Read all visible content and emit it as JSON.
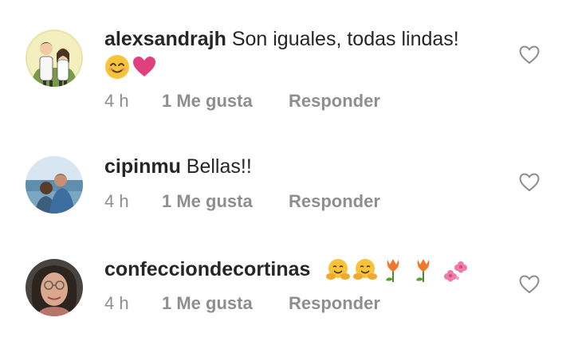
{
  "comments": [
    {
      "username": "alexsandrajh",
      "text": "Son iguales, todas lindas!",
      "emojis": [
        "smiling-face-emoji",
        "pink-heart-emoji"
      ],
      "time": "4 h",
      "likes": "1 Me gusta",
      "reply": "Responder",
      "avatar": "couple-illustration-avatar"
    },
    {
      "username": "cipinmu",
      "text": "Bellas!!",
      "emojis": [],
      "time": "4 h",
      "likes": "1 Me gusta",
      "reply": "Responder",
      "avatar": "couple-beach-photo-avatar"
    },
    {
      "username": "confecciondecortinas",
      "text": "",
      "emojis": [
        "hugging-face-emoji",
        "hugging-face-emoji",
        "tulip-emoji",
        "tulip-emoji",
        "cherry-blossom-emoji"
      ],
      "time": "4 h",
      "likes": "1 Me gusta",
      "reply": "Responder",
      "avatar": "woman-glasses-photo-avatar"
    }
  ],
  "colors": {
    "primary_text": "#262626",
    "secondary_text": "#8e8e8e",
    "heart_outline": "#8e8e8e"
  },
  "icons": {
    "like": "heart-outline-icon"
  }
}
